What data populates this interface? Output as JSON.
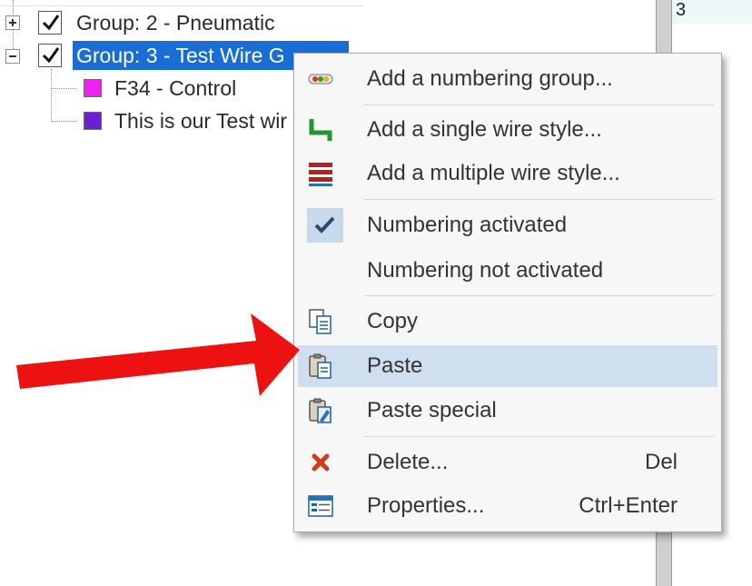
{
  "tree": {
    "rows": [
      {
        "label": "Group: 2 - Pneumatic"
      },
      {
        "label": "Group: 3 - Test Wire G"
      },
      {
        "label": "F34 - Control",
        "color": "#ee22ee"
      },
      {
        "label": "This is our Test wir",
        "color": "#6a1fd0"
      }
    ]
  },
  "right_panel": {
    "value": "3"
  },
  "context_menu": {
    "items": [
      {
        "label": "Add a numbering group...",
        "icon": "numbering-group-icon"
      },
      {
        "label": "Add a single wire style...",
        "icon": "single-wire-icon"
      },
      {
        "label": "Add a multiple wire style...",
        "icon": "multiple-wire-icon"
      },
      {
        "label": "Numbering activated",
        "icon": "checkmark-icon",
        "checked": true
      },
      {
        "label": "Numbering not activated"
      },
      {
        "label": "Copy",
        "icon": "copy-icon"
      },
      {
        "label": "Paste",
        "icon": "paste-icon",
        "highlighted": true
      },
      {
        "label": "Paste special",
        "icon": "paste-special-icon"
      },
      {
        "label": "Delete...",
        "shortcut": "Del",
        "icon": "delete-icon"
      },
      {
        "label": "Properties...",
        "shortcut": "Ctrl+Enter",
        "icon": "properties-icon"
      }
    ]
  },
  "colors": {
    "selection": "#1a6dd4",
    "menu_highlight": "#cfdff0",
    "arrow": "#ee1111"
  }
}
